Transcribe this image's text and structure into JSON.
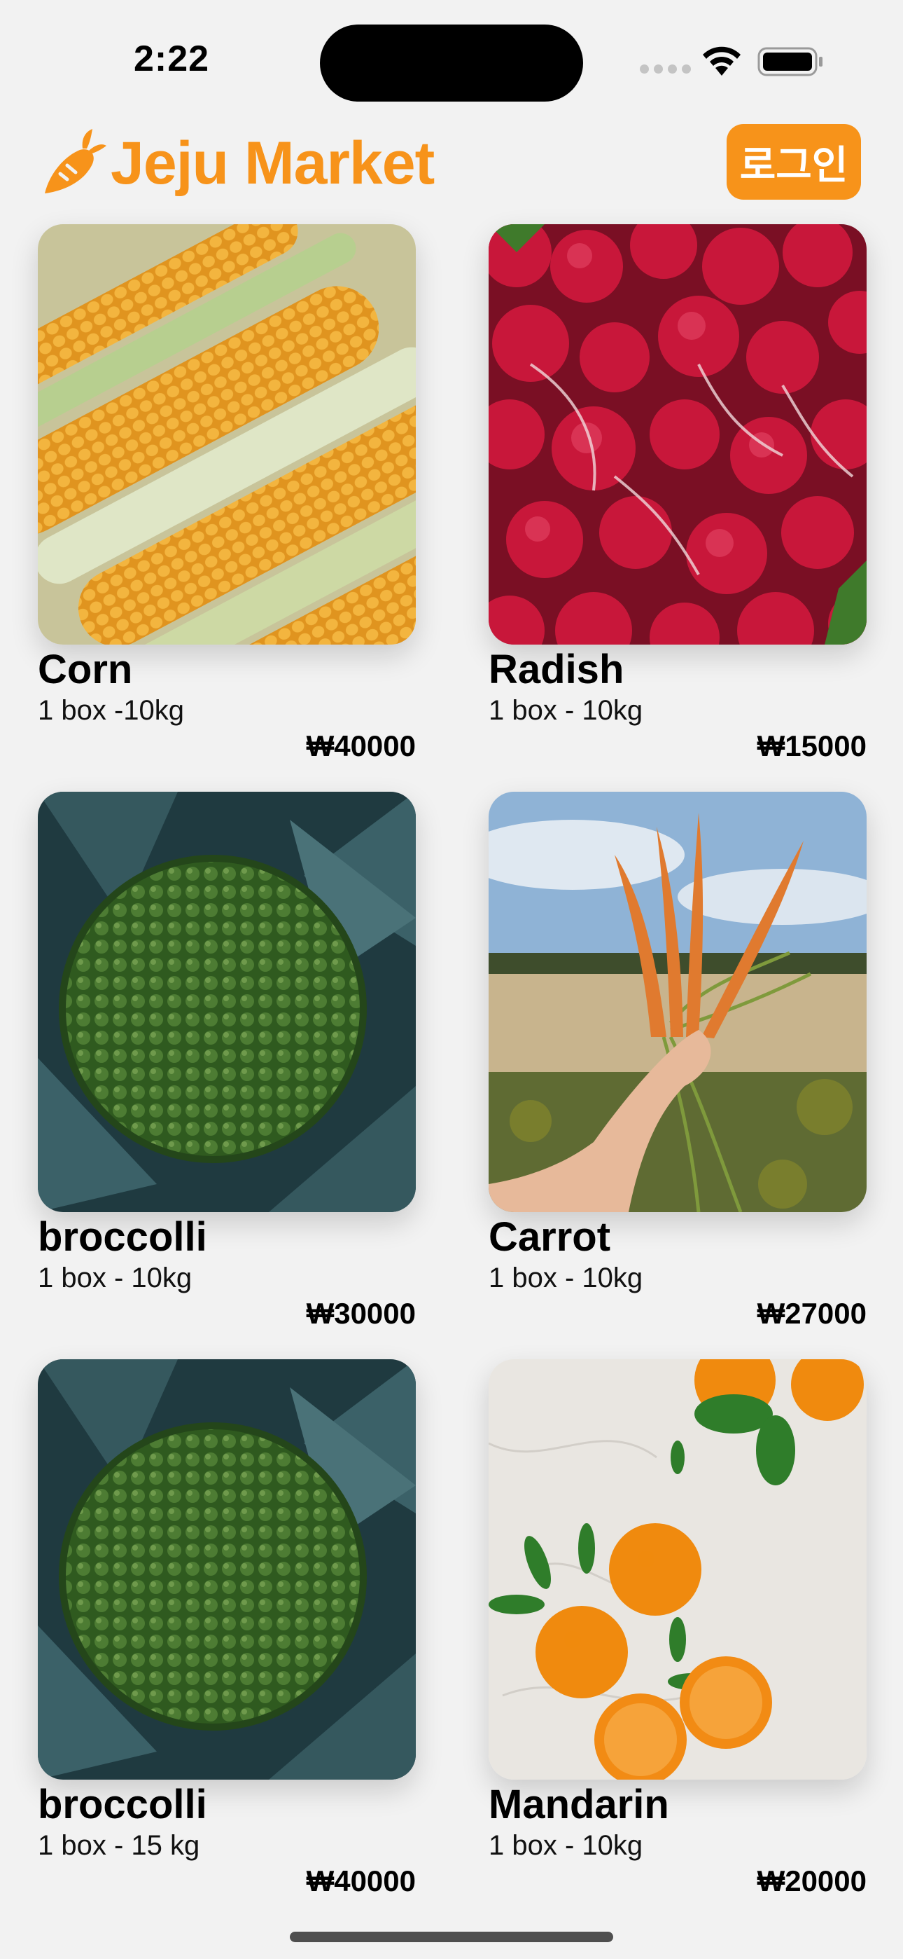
{
  "status_bar": {
    "time": "2:22"
  },
  "header": {
    "title": "Jeju Market",
    "login_label": "로그인"
  },
  "products": [
    {
      "name": "Corn",
      "desc": "1 box -10kg",
      "price": "₩40000"
    },
    {
      "name": "Radish",
      "desc": "1 box - 10kg",
      "price": "₩15000"
    },
    {
      "name": "broccolli",
      "desc": "1 box - 10kg",
      "price": "₩30000"
    },
    {
      "name": "Carrot",
      "desc": "1 box - 10kg",
      "price": "₩27000"
    },
    {
      "name": "broccolli",
      "desc": "1 box - 15 kg",
      "price": "₩40000"
    },
    {
      "name": "Mandarin",
      "desc": "1 box - 10kg",
      "price": "₩20000"
    }
  ],
  "colors": {
    "accent": "#f7931a",
    "background": "#f2f2f2"
  },
  "icons": [
    "carrot-logo-icon",
    "wifi-icon",
    "battery-icon",
    "cellular-signal-icon"
  ]
}
